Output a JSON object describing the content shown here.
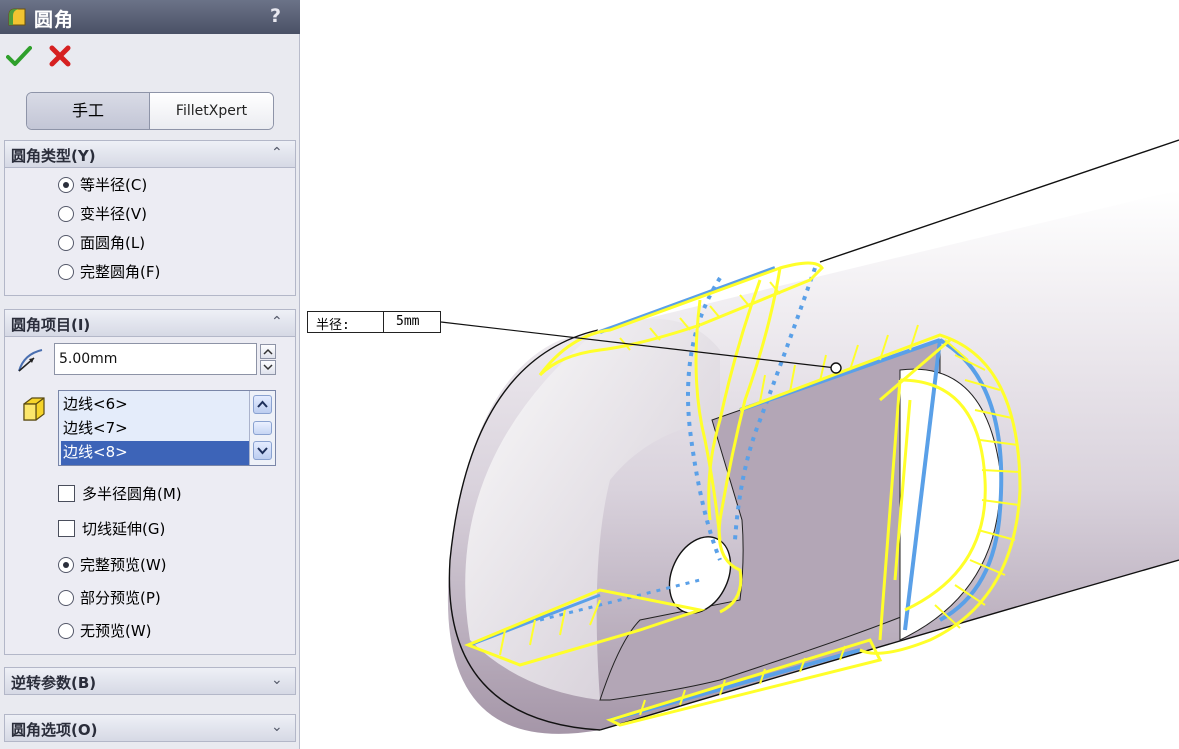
{
  "panel": {
    "title": "圆角",
    "help": "?",
    "tabs": [
      {
        "label": "手工"
      },
      {
        "label": "FilletXpert"
      }
    ],
    "fillet_type": {
      "header": "圆角类型(Y)",
      "options": [
        {
          "label": "等半径(C)",
          "selected": true
        },
        {
          "label": "变半径(V)",
          "selected": false
        },
        {
          "label": "面圆角(L)",
          "selected": false
        },
        {
          "label": "完整圆角(F)",
          "selected": false
        }
      ]
    },
    "fillet_items": {
      "header": "圆角项目(I)",
      "radius_value": "5.00mm",
      "edges": [
        "边线<6>",
        "边线<7>",
        "边线<8>"
      ],
      "selected_edge_index": 2,
      "multi_radius": "多半径圆角(M)",
      "tangent_propagation": "切线延伸(G)",
      "preview_options": [
        {
          "label": "完整预览(W)",
          "selected": true
        },
        {
          "label": "部分预览(P)",
          "selected": false
        },
        {
          "label": "无预览(W)",
          "selected": false
        }
      ]
    },
    "setback": {
      "header": "逆转参数(B)"
    },
    "fillet_options": {
      "header": "圆角选项(O)"
    }
  },
  "viewport": {
    "callout_label": "半径:",
    "callout_value": "5mm"
  },
  "colors": {
    "preview_yellow": "#ffff2a",
    "edge_blue": "#5aa0e8",
    "part_face": "#b3a6b6",
    "titlebar": "#5a6177"
  }
}
